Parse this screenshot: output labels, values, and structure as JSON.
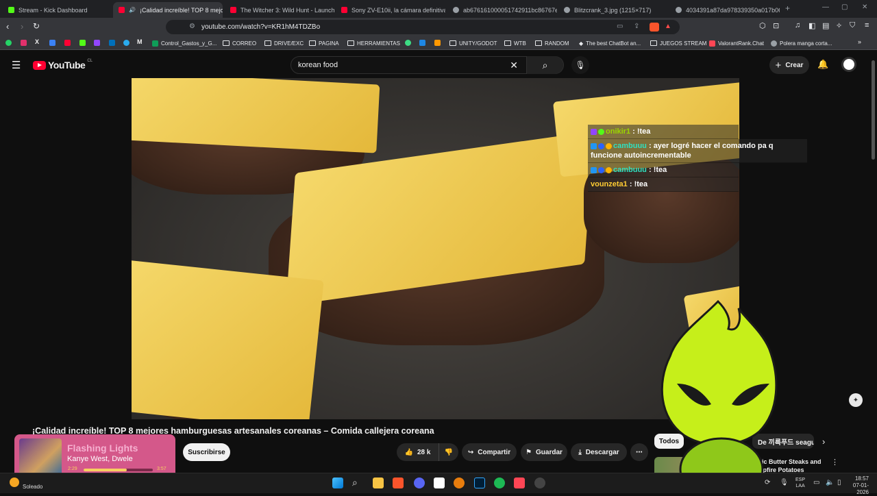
{
  "tabs": [
    {
      "label": "Stream - Kick Dashboard",
      "color": "#53fc18"
    },
    {
      "label": "¡Calidad increíble! TOP 8 mejores",
      "color": "#ff0033"
    },
    {
      "label": "The Witcher 3: Wild Hunt - Launch C",
      "color": "#ff0033"
    },
    {
      "label": "Sony ZV-E10ii, la cámara definitiva p",
      "color": "#ff0033"
    },
    {
      "label": "ab676161000051742911bc86767e2",
      "color": "#9aa0a6"
    },
    {
      "label": "Blitzcrank_3.jpg (1215×717)",
      "color": "#9aa0a6"
    },
    {
      "label": "4034391a87da978339350a017b06f",
      "color": "#9aa0a6"
    }
  ],
  "address": {
    "url": "youtube.com/watch?v=KR1hM4TDZBo"
  },
  "bookmarks": [
    "Control_Gastos_y_G...",
    "CORREO",
    "DRIVE/EXC",
    "PAGINA",
    "HERRAMIENTAS",
    "UNITY/GODOT",
    "WTB",
    "RANDOM",
    "The best ChatBot an...",
    "JUEGOS STREAM",
    "ValorantRank.Chat",
    "Polera manga corta..."
  ],
  "youtube": {
    "logo": "YouTube",
    "region": "CL",
    "search_value": "korean food",
    "create_label": "Crear"
  },
  "video": {
    "title": "¡Calidad increíble! TOP 8 mejores hamburguesas artesanales coreanas – Comida callejera coreana",
    "subscribe": "Suscribirse",
    "likes": "28 k",
    "share": "Compartir",
    "save": "Guardar",
    "download": "Descargar"
  },
  "chat": [
    {
      "user": "onikir1",
      "msg": "!tea",
      "color": "#9bd600"
    },
    {
      "user": "cambuuu",
      "msg": "ayer logré hacer el comando pa q funcione autoincrementable",
      "color": "#2fe0c0"
    },
    {
      "user": "cambuuu",
      "msg": "!tea",
      "color": "#2fe0c0"
    },
    {
      "user": "vounzeta1",
      "msg": "!tea",
      "color": "#ffcc33"
    }
  ],
  "chips": {
    "all": "Todos",
    "next": "De 끼륵푸드 seagu"
  },
  "related": {
    "title": "Garlic Butter Steaks and Campfire Potatoes"
  },
  "music": {
    "title": "Flashing Lights",
    "artist": "Kanye West, Dwele",
    "elapsed": "2:29",
    "total": "3:57",
    "progress": 0.62
  },
  "weather": {
    "label": "Soleado"
  },
  "tray": {
    "lang1": "ESP",
    "lang2": "LAA",
    "time": "18:57",
    "date": "07-01-2026"
  },
  "colors": {
    "accent": "#ff0033",
    "mascot": "#c6ef1a",
    "music_bg": "#d4588a"
  }
}
